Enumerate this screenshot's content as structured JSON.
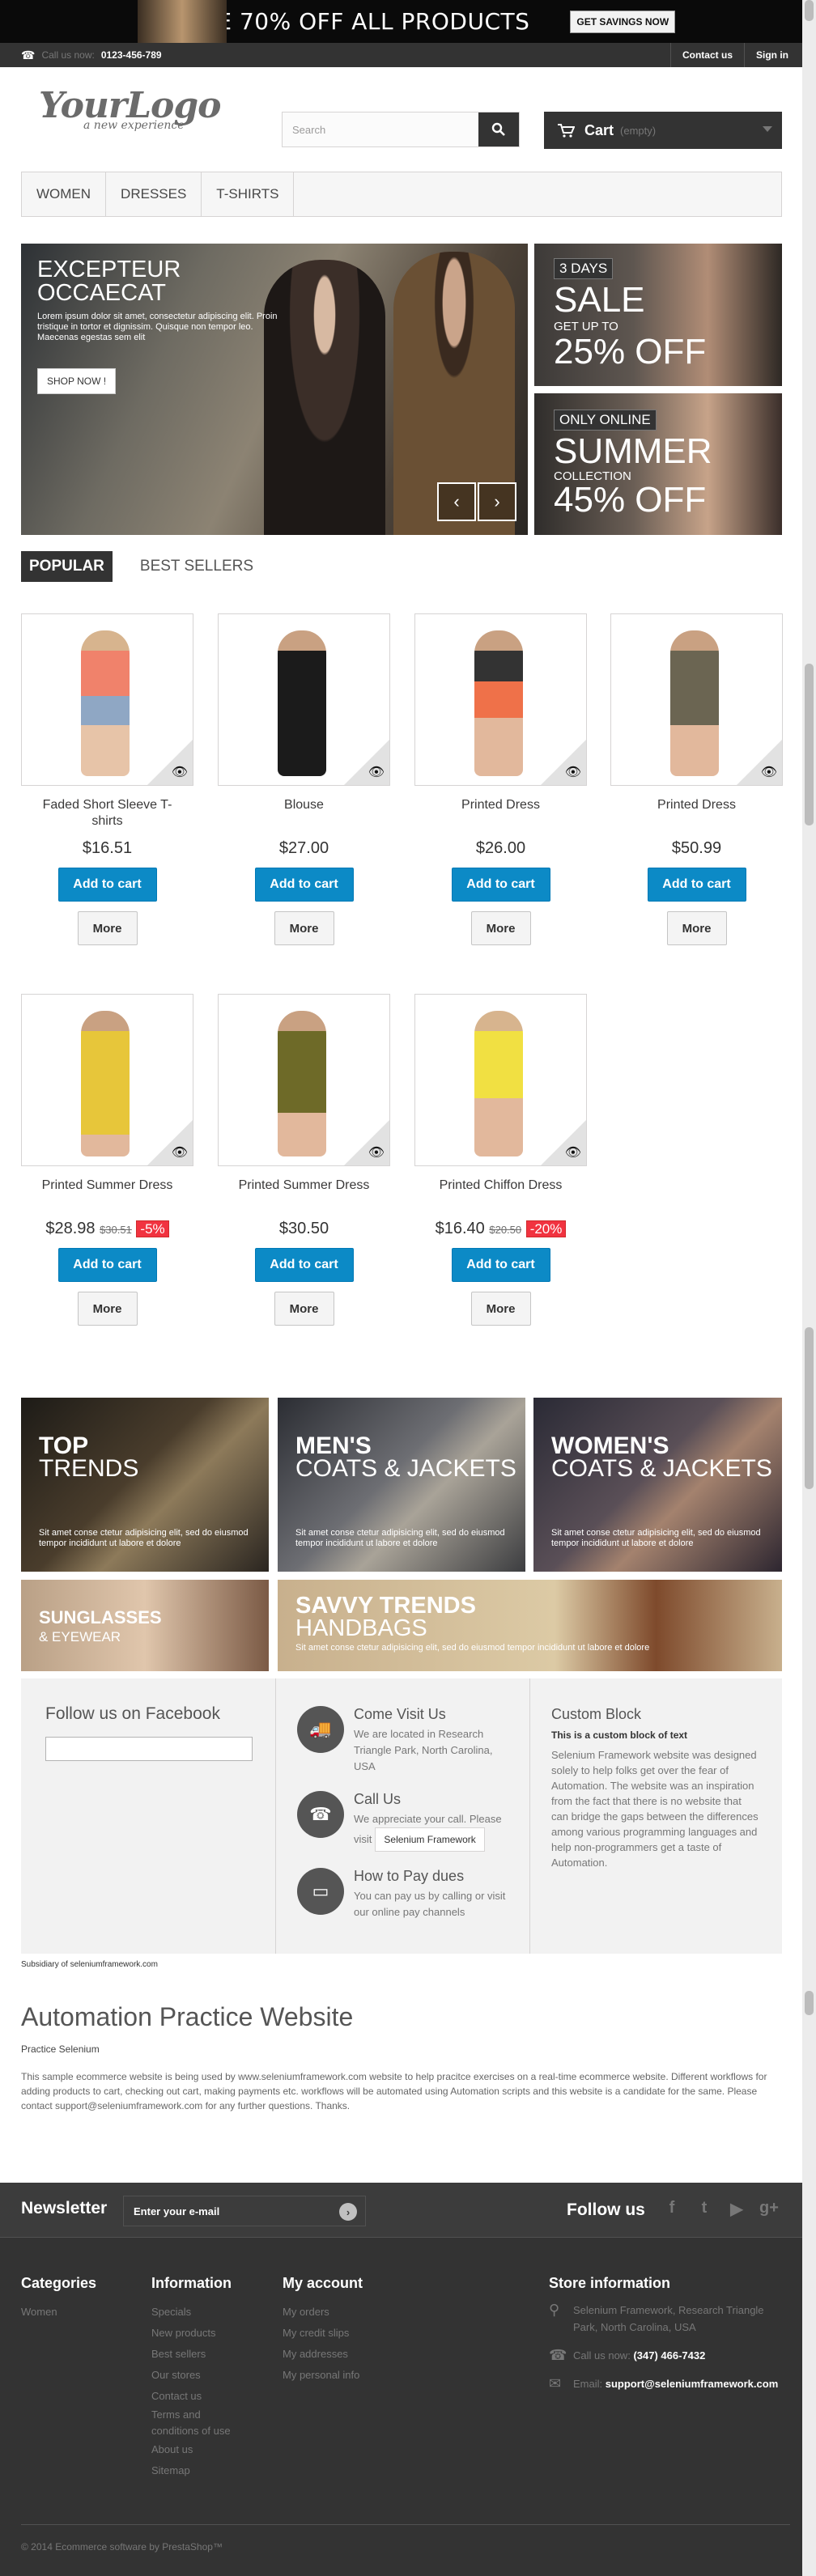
{
  "promo": {
    "text": "SALE 70% OFF ALL PRODUCTS",
    "button": "GET SAVINGS NOW"
  },
  "topnav": {
    "call_label": "Call us now:",
    "phone": "0123-456-789",
    "contact": "Contact us",
    "signin": "Sign in"
  },
  "logo": {
    "title": "YourLogo",
    "subtitle": "a new experience"
  },
  "search": {
    "placeholder": "Search"
  },
  "cart": {
    "label": "Cart",
    "status": "(empty)"
  },
  "menu": [
    "WOMEN",
    "DRESSES",
    "T-SHIRTS"
  ],
  "slider": {
    "title_line1": "EXCEPTEUR",
    "title_line2": "OCCAECAT",
    "text": "Lorem ipsum dolor sit amet, consectetur adipiscing elit. Proin tristique in tortor et dignissim. Quisque non tempor leo. Maecenas egestas sem elit",
    "button": "SHOP NOW !"
  },
  "side_banners": [
    {
      "tag": "3 DAYS",
      "big": "SALE",
      "small": "GET UP TO",
      "percent": "25% OFF"
    },
    {
      "tag": "ONLY ONLINE",
      "big": "SUMMER",
      "small": "COLLECTION",
      "percent": "45% OFF"
    }
  ],
  "tabs": {
    "popular": "POPULAR",
    "best": "BEST SELLERS"
  },
  "products": [
    {
      "name": "Faded Short Sleeve T-shirts",
      "price": "$16.51",
      "old": "",
      "discount": "",
      "color": "#f0826b"
    },
    {
      "name": "Blouse",
      "price": "$27.00",
      "old": "",
      "discount": "",
      "color": "#1b1b1b"
    },
    {
      "name": "Printed Dress",
      "price": "$26.00",
      "old": "",
      "discount": "",
      "color": "#ef7149"
    },
    {
      "name": "Printed Dress",
      "price": "$50.99",
      "old": "",
      "discount": "",
      "color": "#6b6552"
    },
    {
      "name": "Printed Summer Dress",
      "price": "$28.98",
      "old": "$30.51",
      "discount": "-5%",
      "color": "#e7c63a"
    },
    {
      "name": "Printed Summer Dress",
      "price": "$30.50",
      "old": "",
      "discount": "",
      "color": "#6e6a28"
    },
    {
      "name": "Printed Chiffon Dress",
      "price": "$16.40",
      "old": "$20.50",
      "discount": "-20%",
      "color": "#f1e042"
    }
  ],
  "product_buttons": {
    "add": "Add to cart",
    "more": "More"
  },
  "promo_blocks": [
    {
      "l1": "TOP",
      "l2": "TRENDS",
      "text": "Sit amet conse ctetur adipisicing elit, sed do eiusmod tempor incididunt ut labore et dolore"
    },
    {
      "l1": "MEN'S",
      "l2": "COATS & JACKETS",
      "text": "Sit amet conse ctetur adipisicing elit, sed do eiusmod tempor incididunt ut labore et dolore"
    },
    {
      "l1": "WOMEN'S",
      "l2": "COATS & JACKETS",
      "text": "Sit amet conse ctetur adipisicing elit, sed do eiusmod tempor incididunt ut labore et dolore"
    },
    {
      "l1": "SUNGLASSES",
      "l2": "& EYEWEAR",
      "text": ""
    },
    {
      "l1": "SAVVY TRENDS",
      "l2": "HANDBAGS",
      "text": "Sit amet conse ctetur adipisicing elit, sed do eiusmod tempor incididunt ut labore et dolore"
    }
  ],
  "info": {
    "facebook": "Follow us on Facebook",
    "visit_h": "Come Visit Us",
    "visit_t": "We are located in Research Triangle Park, North Carolina, USA",
    "call_h": "Call Us",
    "call_t": "We appreciate your call. Please visit",
    "call_btn": "Selenium Framework",
    "pay_h": "How to Pay dues",
    "pay_t": "You can pay us by calling or visit our online pay channels",
    "custom_h": "Custom Block",
    "custom_sub": "This is a custom block of text",
    "custom_t": "Selenium Framework website was designed solely to help folks get over the fear of Automation. The website was an inspiration from the fact that there is no website that can bridge the gaps between the differences among various programming languages and help non-programmers get a taste of Automation."
  },
  "subsidiary": "Subsidiary of seleniumframework.com",
  "about": {
    "title": "Automation Practice Website",
    "subtitle": "Practice Selenium",
    "desc": "This sample ecommerce website is being used by www.seleniumframework.com website to help pracitce exercises on a real-time ecommerce website. Different workflows for adding products to cart, checking out cart, making payments etc. workflows will be automated using Automation scripts and this website is a candidate for the same. Please contact support@seleniumframework.com for any further questions. Thanks."
  },
  "newsletter": {
    "title": "Newsletter",
    "placeholder": "Enter your e-mail",
    "follow": "Follow us"
  },
  "footer": {
    "categories_h": "Categories",
    "categories": [
      "Women"
    ],
    "information_h": "Information",
    "information": [
      "Specials",
      "New products",
      "Best sellers",
      "Our stores",
      "Contact us",
      "Terms and conditions of use",
      "About us",
      "Sitemap"
    ],
    "account_h": "My account",
    "account": [
      "My orders",
      "My credit slips",
      "My addresses",
      "My personal info"
    ],
    "store_h": "Store information",
    "address": "Selenium Framework, Research Triangle Park, North Carolina, USA",
    "call_label": "Call us now:",
    "phone": "(347) 466-7432",
    "email_label": "Email:",
    "email": "support@seleniumframework.com",
    "copyright": "© 2014 Ecommerce software by PrestaShop™"
  }
}
